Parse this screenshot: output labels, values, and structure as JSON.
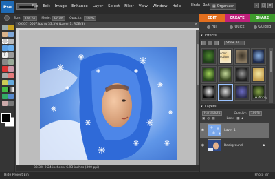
{
  "app": {
    "logo": "Pse",
    "menus": [
      "File",
      "Edit",
      "Image",
      "Enhance",
      "Layer",
      "Select",
      "Filter",
      "View",
      "Window",
      "Help"
    ],
    "undo_label": "Undo",
    "redo_label": "Redo",
    "organizer_label": "Organizer",
    "window_controls": [
      "–",
      "□",
      "×"
    ]
  },
  "mode_tabs": [
    "EDIT",
    "CREATE",
    "SHARE"
  ],
  "options_bar": {
    "size_label": "Size:",
    "size_value": "100 px",
    "mode_label": "Mode:",
    "mode_value": "Brush",
    "opacity_label": "Opacity:",
    "opacity_value": "100%"
  },
  "fix_tabs": [
    "Full",
    "Quick",
    "Guided"
  ],
  "document": {
    "tab_title": "C0557_0007.jpg @ 33.3% (Layer 1, RGB/8)",
    "close_glyph": "×",
    "status_text": "33.3%   9.24 inches x 6.93 inches (300 ppi)"
  },
  "effects": {
    "header": "Effects",
    "filter_select": "Show All",
    "tiles": [
      {
        "label": "",
        "color_a": "#1f3d1a",
        "color_b": "#4f8a2e"
      },
      {
        "label": "color\ncotton",
        "color_a": "#f4e9c8",
        "color_b": "#f1d08c"
      },
      {
        "label": "",
        "color_a": "#8a7a62",
        "color_b": "#3a3226"
      },
      {
        "label": "",
        "color_a": "#1f2b4b",
        "color_b": "#8cb4e6"
      },
      {
        "label": "",
        "color_a": "#2a4a1a",
        "color_b": "#a4d45a"
      },
      {
        "label": "",
        "color_a": "#3a4a22",
        "color_b": "#c4d89a"
      },
      {
        "label": "",
        "color_a": "#202020",
        "color_b": "#9a9a9a"
      },
      {
        "label": "",
        "color_a": "#c4a050",
        "color_b": "#f4e7a2"
      },
      {
        "label": "",
        "color_a": "#0a0a0a",
        "color_b": "#ececec"
      },
      {
        "label": "",
        "color_a": "#2a2a2a",
        "color_b": "#dcdcdc"
      },
      {
        "label": "",
        "color_a": "#2b2b4c",
        "color_b": "#6c6cc4"
      },
      {
        "label": "",
        "color_a": "#1c2a12",
        "color_b": "#8aa84a"
      }
    ],
    "apply_label": "Apply"
  },
  "layers": {
    "header": "Layers",
    "blend_mode": "Hard Light",
    "opacity_label": "Opacity:",
    "opacity_value": "100%",
    "lock_label": "Lock:",
    "rows": [
      {
        "name": "Layer 1",
        "active": true
      },
      {
        "name": "Background",
        "active": false
      }
    ]
  },
  "project_bin": {
    "left_label": "Hide Project Bin",
    "right_label": "Photo Bin"
  },
  "colors": {
    "edit": "#e36f1e",
    "create": "#c0207a",
    "share": "#3e9a2c"
  }
}
